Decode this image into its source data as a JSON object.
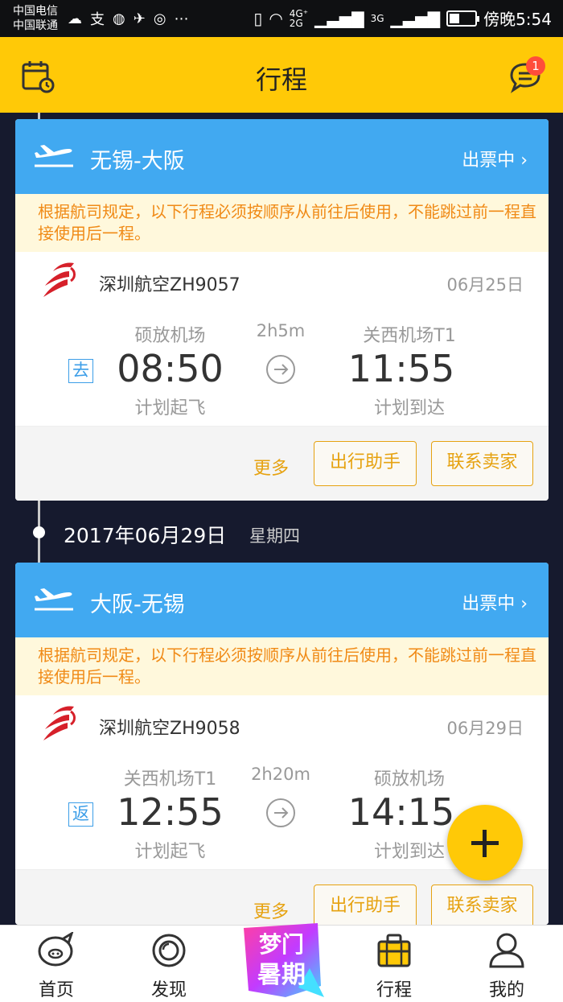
{
  "status_bar": {
    "carrier_1": "中国电信",
    "carrier_2": "中国联通",
    "network_4g": "4G⁺",
    "network_2g": "2G",
    "network_3g": "3G",
    "time": "傍晚5:54",
    "battery_level": 0.4
  },
  "header": {
    "title": "行程",
    "message_badge": "1"
  },
  "trips": [
    {
      "route": "无锡-大阪",
      "status": "出票中 ›",
      "notice": "根据航司规定，以下行程必须按顺序从前往后使用，不能跳过前一程直接使用后一程。",
      "flight_no": "深圳航空ZH9057",
      "date": "06月25日",
      "direction": "去",
      "dep_airport": "硕放机场",
      "dep_time": "08:50",
      "dep_label": "计划起飞",
      "duration": "2h5m",
      "arr_airport": "关西机场T1",
      "arr_time": "11:55",
      "arr_label": "计划到达",
      "more": "更多",
      "assistant": "出行助手",
      "contact": "联系卖家"
    },
    {
      "route": "大阪-无锡",
      "status": "出票中 ›",
      "notice": "根据航司规定，以下行程必须按顺序从前往后使用，不能跳过前一程直接使用后一程。",
      "flight_no": "深圳航空ZH9058",
      "date": "06月29日",
      "direction": "返",
      "dep_airport": "关西机场T1",
      "dep_time": "12:55",
      "dep_label": "计划起飞",
      "duration": "2h20m",
      "arr_airport": "硕放机场",
      "arr_time": "14:15",
      "arr_label": "计划到达",
      "more": "更多",
      "assistant": "出行助手",
      "contact": "联系卖家"
    }
  ],
  "timeline": {
    "date": "2017年06月29日",
    "weekday": "星期四"
  },
  "bottom_nav": {
    "home": "首页",
    "discover": "发现",
    "promo_text": "暑期",
    "trips": "行程",
    "mine": "我的"
  },
  "colors": {
    "brand_yellow": "#ffc907",
    "card_blue": "#41a9f1",
    "accent_orange": "#e6a210",
    "notice_text": "#f08a16",
    "background": "#161a2e"
  }
}
